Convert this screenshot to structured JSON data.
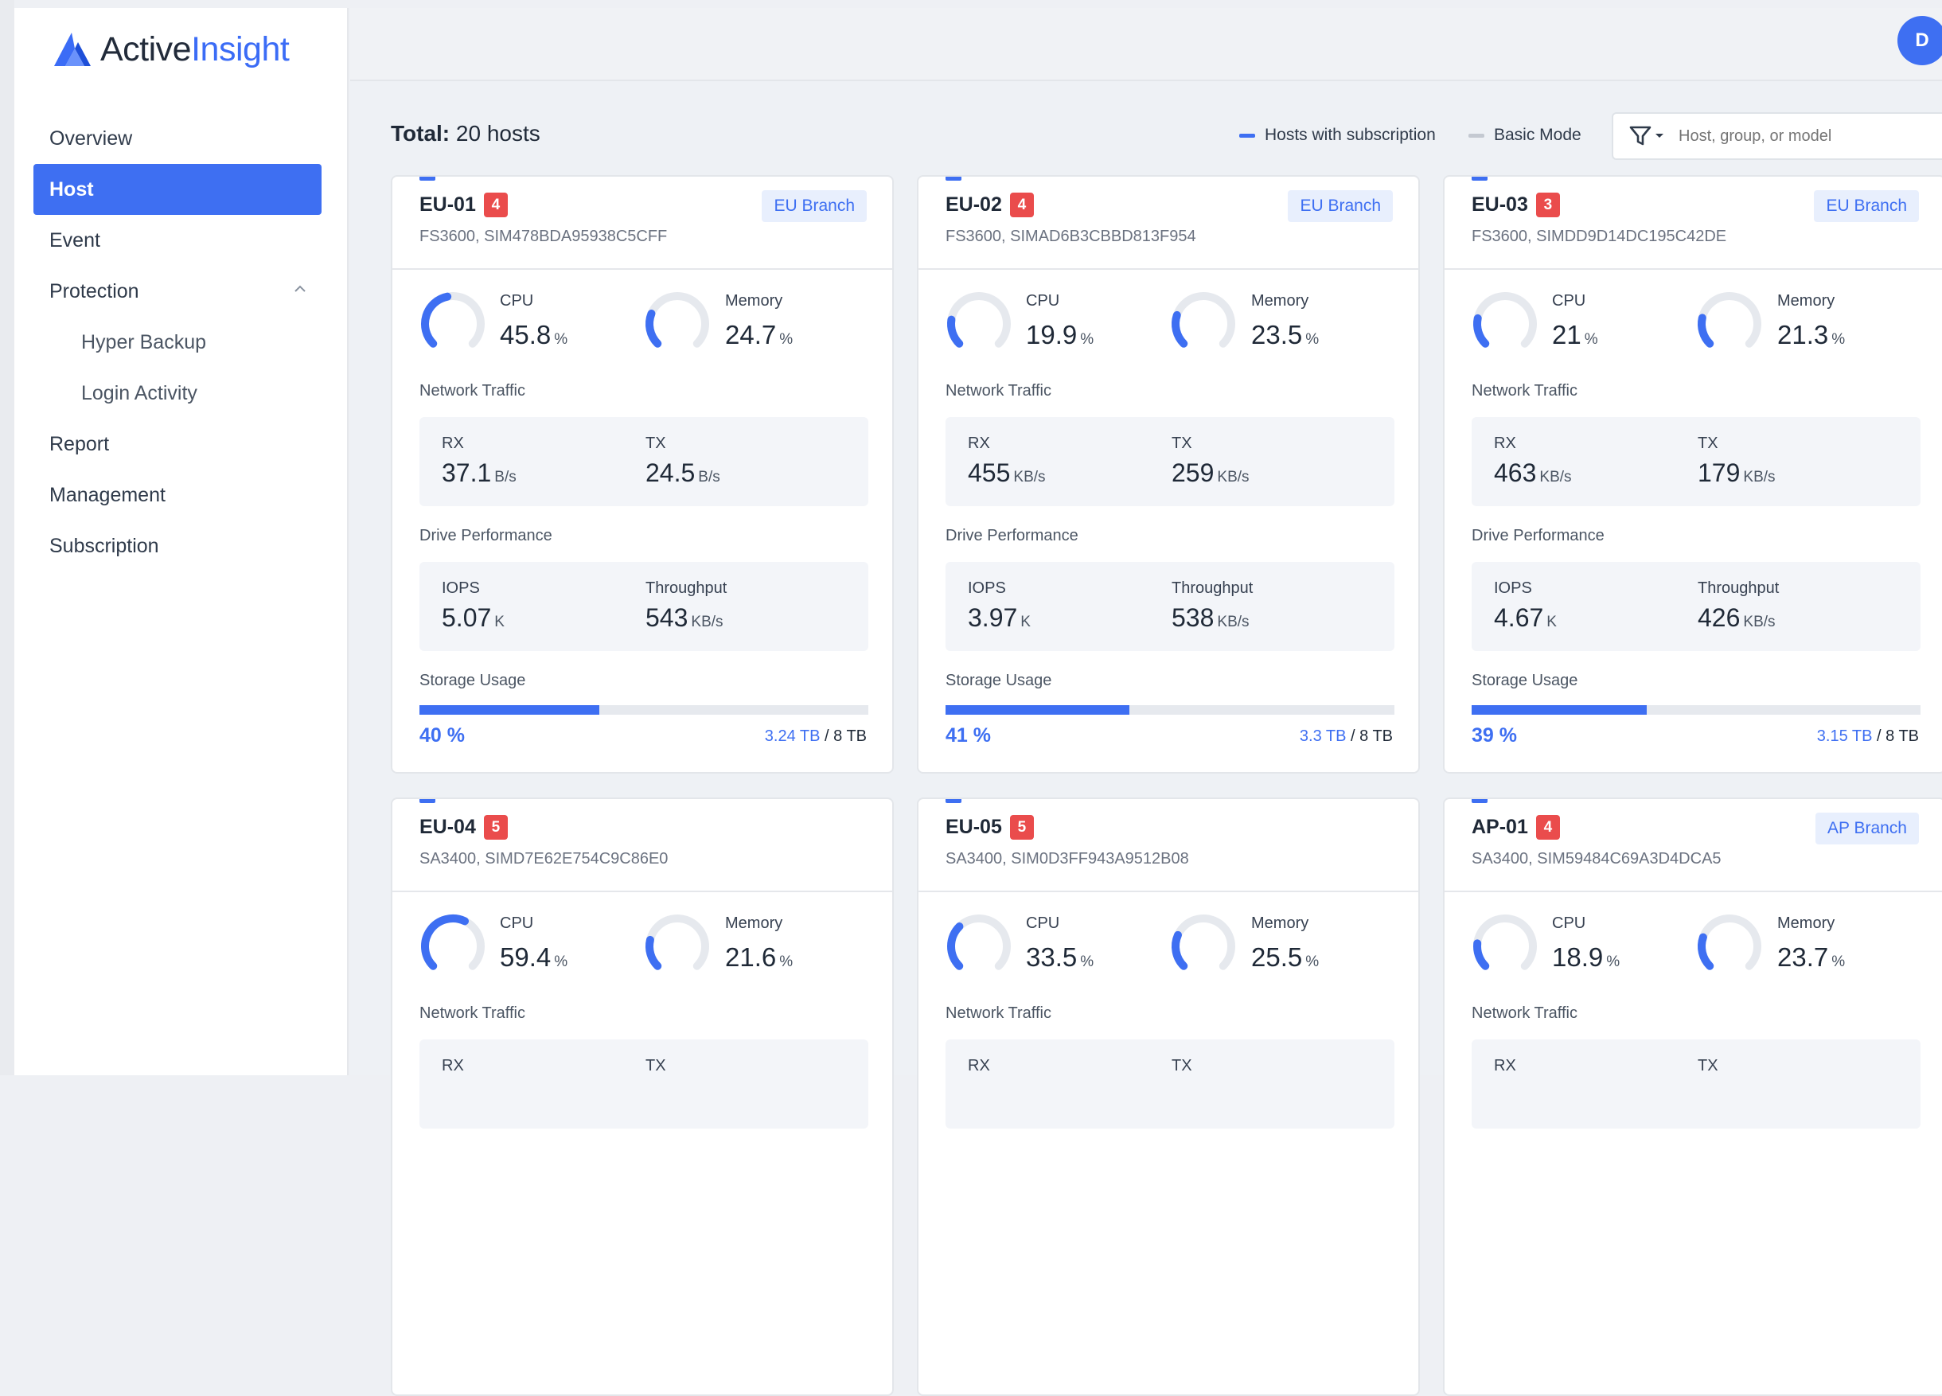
{
  "app": {
    "name_part1": "Active",
    "name_part2": "Insight"
  },
  "user": {
    "initial": "D"
  },
  "nav": [
    {
      "label": "Overview",
      "active": false,
      "sub": false
    },
    {
      "label": "Host",
      "active": true,
      "sub": false
    },
    {
      "label": "Event",
      "active": false,
      "sub": false
    },
    {
      "label": "Protection",
      "active": false,
      "sub": false,
      "expandable": true
    },
    {
      "label": "Hyper Backup",
      "active": false,
      "sub": true
    },
    {
      "label": "Login Activity",
      "active": false,
      "sub": true
    },
    {
      "label": "Report",
      "active": false,
      "sub": false
    },
    {
      "label": "Management",
      "active": false,
      "sub": false
    },
    {
      "label": "Subscription",
      "active": false,
      "sub": false
    }
  ],
  "toolbar": {
    "total_label": "Total:",
    "total_value": "20 hosts",
    "legend_subscription": "Hosts with subscription",
    "legend_basic": "Basic Mode",
    "filter_placeholder": "Host, group, or model"
  },
  "colors": {
    "accent": "#3e6ff2",
    "badge": "#ea4c4c",
    "basic": "#c4c9d1"
  },
  "labels": {
    "cpu": "CPU",
    "memory": "Memory",
    "network": "Network Traffic",
    "rx": "RX",
    "tx": "TX",
    "drive": "Drive Performance",
    "iops": "IOPS",
    "throughput": "Throughput",
    "storage": "Storage Usage"
  },
  "hosts": [
    {
      "name": "EU-01",
      "alerts": "4",
      "branch": "EU Branch",
      "model": "FS3600, SIM478BDA95938C5CFF",
      "cpu": "45.8",
      "cpu_frac": 0.458,
      "mem": "24.7",
      "mem_frac": 0.247,
      "rx": "37.1",
      "rx_unit": "B/s",
      "tx": "24.5",
      "tx_unit": "B/s",
      "iops": "5.07",
      "iops_unit": "K",
      "thr": "543",
      "thr_unit": "KB/s",
      "storage_pct": "40 %",
      "storage_frac": 0.4,
      "used": "3.24 TB",
      "total": " / 8 TB"
    },
    {
      "name": "EU-02",
      "alerts": "4",
      "branch": "EU Branch",
      "model": "FS3600, SIMAD6B3CBBD813F954",
      "cpu": "19.9",
      "cpu_frac": 0.199,
      "mem": "23.5",
      "mem_frac": 0.235,
      "rx": "455",
      "rx_unit": "KB/s",
      "tx": "259",
      "tx_unit": "KB/s",
      "iops": "3.97",
      "iops_unit": "K",
      "thr": "538",
      "thr_unit": "KB/s",
      "storage_pct": "41 %",
      "storage_frac": 0.41,
      "used": "3.3 TB",
      "total": " / 8 TB"
    },
    {
      "name": "EU-03",
      "alerts": "3",
      "branch": "EU Branch",
      "model": "FS3600, SIMDD9D14DC195C42DE",
      "cpu": "21",
      "cpu_frac": 0.21,
      "mem": "21.3",
      "mem_frac": 0.213,
      "rx": "463",
      "rx_unit": "KB/s",
      "tx": "179",
      "tx_unit": "KB/s",
      "iops": "4.67",
      "iops_unit": "K",
      "thr": "426",
      "thr_unit": "KB/s",
      "storage_pct": "39 %",
      "storage_frac": 0.39,
      "used": "3.15 TB",
      "total": " / 8 TB"
    },
    {
      "name": "EU-04",
      "alerts": "5",
      "branch": "",
      "model": "SA3400, SIMD7E62E754C9C86E0",
      "cpu": "59.4",
      "cpu_frac": 0.594,
      "mem": "21.6",
      "mem_frac": 0.216,
      "rx": "",
      "rx_unit": "",
      "tx": "",
      "tx_unit": "",
      "iops": "",
      "iops_unit": "",
      "thr": "",
      "thr_unit": "",
      "storage_pct": "",
      "storage_frac": 0,
      "used": "",
      "total": ""
    },
    {
      "name": "EU-05",
      "alerts": "5",
      "branch": "",
      "model": "SA3400, SIM0D3FF943A9512B08",
      "cpu": "33.5",
      "cpu_frac": 0.335,
      "mem": "25.5",
      "mem_frac": 0.255,
      "rx": "",
      "rx_unit": "",
      "tx": "",
      "tx_unit": "",
      "iops": "",
      "iops_unit": "",
      "thr": "",
      "thr_unit": "",
      "storage_pct": "",
      "storage_frac": 0,
      "used": "",
      "total": ""
    },
    {
      "name": "AP-01",
      "alerts": "4",
      "branch": "AP Branch",
      "model": "SA3400, SIM59484C69A3D4DCA5",
      "cpu": "18.9",
      "cpu_frac": 0.189,
      "mem": "23.7",
      "mem_frac": 0.237,
      "rx": "",
      "rx_unit": "",
      "tx": "",
      "tx_unit": "",
      "iops": "",
      "iops_unit": "",
      "thr": "",
      "thr_unit": "",
      "storage_pct": "",
      "storage_frac": 0,
      "used": "",
      "total": ""
    }
  ]
}
